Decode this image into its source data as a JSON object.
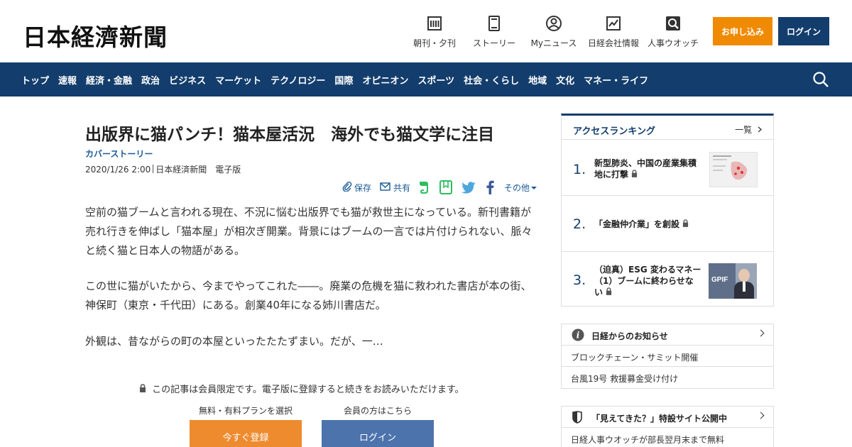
{
  "header": {
    "logo": "日本経濟新聞",
    "nav": [
      {
        "label": "朝刊・夕刊",
        "icon": "newspaper-icon"
      },
      {
        "label": "ストーリー",
        "icon": "book-icon"
      },
      {
        "label": "Myニュース",
        "icon": "user-icon"
      },
      {
        "label": "日経会社情報",
        "icon": "chart-icon"
      },
      {
        "label": "人事ウオッチ",
        "icon": "search-person-icon"
      }
    ],
    "apply_label": "お申し込み",
    "login_label": "ログイン"
  },
  "navbar": {
    "items": [
      "トップ",
      "速報",
      "経済・金融",
      "政治",
      "ビジネス",
      "マーケット",
      "テクノロジー",
      "国際",
      "オピニオン",
      "スポーツ",
      "社会・くらし",
      "地域",
      "文化",
      "マネー・ライフ"
    ]
  },
  "article": {
    "title": "出版界に猫パンチ！猫本屋活況　海外でも猫文学に注目",
    "section": "カバーストーリー",
    "date": "2020/1/26 2:00",
    "source": "日本経済新聞　電子版",
    "share": {
      "save": "保存",
      "share": "共有",
      "more": "その他"
    },
    "paragraphs": [
      "空前の猫ブームと言われる現在、不況に悩む出版界でも猫が救世主になっている。新刊書籍が売れ行きを伸ばし「猫本屋」が相次ぎ開業。背景にはブームの一言では片付けられない、脈々と続く猫と日本人の物語がある。",
      "この世に猫がいたから、今までやってこれた――。廃業の危機を猫に救われた書店が本の街、神保町（東京・千代田）にある。創業40年になる姉川書店だ。",
      "外観は、昔ながらの町の本屋といったたたずまい。だが、一…"
    ],
    "paywall_note": "この記事は会員限定です。電子版に登録すると続きをお読みいただけます。",
    "plan_label": "無料・有料プランを選択",
    "member_label": "会員の方はこちら",
    "register_button": "今すぐ登録",
    "login_button": "ログイン"
  },
  "ranking": {
    "title": "アクセスランキング",
    "more": "一覧",
    "items": [
      {
        "num": "1.",
        "text_l1": "新型肺炎、中国の産業集積",
        "text_l2": "地に打撃"
      },
      {
        "num": "2.",
        "text_l1": "「金融仲介業」を創設",
        "text_l2": ""
      },
      {
        "num": "3.",
        "text_l1": "（迫真）ESG 変わるマネー",
        "text_l2": "（1）ブームに終わらせな",
        "text_l3": "い"
      }
    ],
    "thumb3_text": "GPIF"
  },
  "notices": {
    "title": "日経からのお知らせ",
    "rows": [
      "ブロックチェーン・サミット開催",
      "台風19号 救援募金受け付け"
    ]
  },
  "special": {
    "title": "「見えてきた？」特設サイト公開中",
    "rows": [
      "日経人事ウオッチが部長翌月末まで無料"
    ]
  },
  "colors": {
    "navy": "#133d6c",
    "orange": "#f08a00",
    "link": "#1a5a96"
  }
}
